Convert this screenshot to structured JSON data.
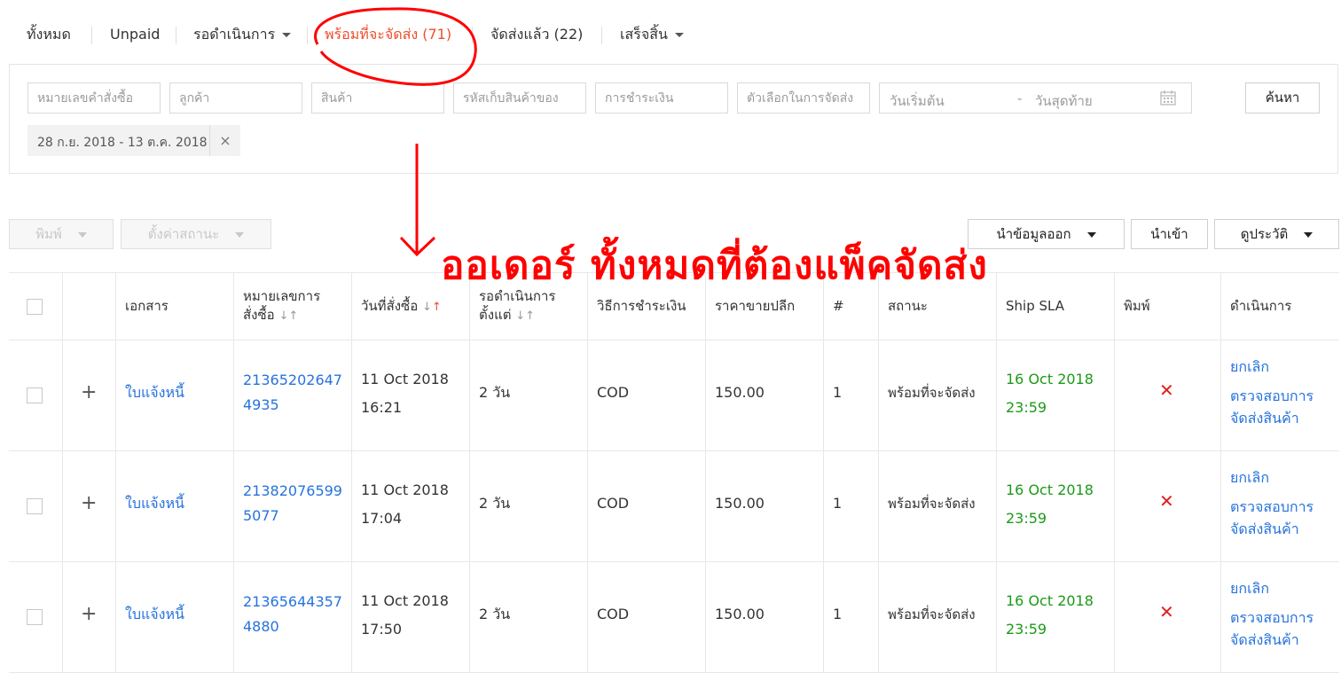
{
  "tabs": [
    {
      "label": "ทั้งหมด"
    },
    {
      "label": "Unpaid"
    },
    {
      "label": "รอดำเนินการ"
    },
    {
      "label": "พร้อมที่จะจัดส่ง (71)"
    },
    {
      "label": "จัดส่งแล้ว (22)"
    },
    {
      "label": "เสร็จสิ้น"
    }
  ],
  "filters": {
    "order_no_placeholder": "หมายเลขคำสั่งซื้อ",
    "customer_placeholder": "ลูกค้า",
    "product_placeholder": "สินค้า",
    "sku_placeholder": "รหัสเก็บสินค้าของ",
    "payment_placeholder": "การชำระเงิน",
    "shipping_option_placeholder": "ตัวเลือกในการจัดส่ง",
    "date_start_placeholder": "วันเริ่มต้น",
    "date_sep": "-",
    "date_end_placeholder": "วันสุดท้าย",
    "search_label": "ค้นหา",
    "date_chip": "28 ก.ย. 2018 - 13 ต.ค. 2018",
    "chip_close": "×"
  },
  "actions": {
    "print": "พิมพ์",
    "set_status": "ตั้งค่าสถานะ",
    "export": "นำข้อมูลออก",
    "import": "นำเข้า",
    "history": "ดูประวัติ"
  },
  "annotation": {
    "text": "ออเดอร์ ทั้งหมดที่ต้องแพ็คจัดส่ง",
    "color": "#ff0000"
  },
  "table": {
    "headers": {
      "document": "เอกสาร",
      "order_no_line1": "หมายเลขการ",
      "order_no_line2": "สั่งซื้อ",
      "order_date": "วันที่สั่งซื้อ",
      "pending_line1": "รอดำเนินการ",
      "pending_line2": "ตั้งแต่",
      "payment": "วิธีการชำระเงิน",
      "retail_price": "ราคาขายปลีก",
      "qty": "#",
      "status": "สถานะ",
      "ship_sla": "Ship SLA",
      "print": "พิมพ์",
      "action": "ดำเนินการ"
    },
    "rows": [
      {
        "doc": "ใบแจ้งหนี้",
        "order_line1": "21365202647",
        "order_line2": "4935",
        "date_line1": "11 Oct 2018",
        "date_line2": "16:21",
        "pending": "2 วัน",
        "payment": "COD",
        "price": "150.00",
        "qty": "1",
        "status": "พร้อมที่จะจัดส่ง",
        "sla_line1": "16 Oct 2018",
        "sla_line2": "23:59",
        "action_cancel": "ยกเลิก",
        "action_check_line1": "ตรวจสอบการ",
        "action_check_line2": "จัดส่งสินค้า"
      },
      {
        "doc": "ใบแจ้งหนี้",
        "order_line1": "21382076599",
        "order_line2": "5077",
        "date_line1": "11 Oct 2018",
        "date_line2": "17:04",
        "pending": "2 วัน",
        "payment": "COD",
        "price": "150.00",
        "qty": "1",
        "status": "พร้อมที่จะจัดส่ง",
        "sla_line1": "16 Oct 2018",
        "sla_line2": "23:59",
        "action_cancel": "ยกเลิก",
        "action_check_line1": "ตรวจสอบการ",
        "action_check_line2": "จัดส่งสินค้า"
      },
      {
        "doc": "ใบแจ้งหนี้",
        "order_line1": "21365644357",
        "order_line2": "4880",
        "date_line1": "11 Oct 2018",
        "date_line2": "17:50",
        "pending": "2 วัน",
        "payment": "COD",
        "price": "150.00",
        "qty": "1",
        "status": "พร้อมที่จะจัดส่ง",
        "sla_line1": "16 Oct 2018",
        "sla_line2": "23:59",
        "action_cancel": "ยกเลิก",
        "action_check_line1": "ตรวจสอบการ",
        "action_check_line2": "จัดส่งสินค้า"
      }
    ]
  },
  "colors": {
    "accent": "#ee4d2d",
    "link": "#2673dd",
    "sla_green": "#1a9a16",
    "cross_red": "#e02020"
  },
  "icons": {
    "expand": "plus-icon",
    "not_printed": "cross-icon",
    "calendar": "calendar-icon",
    "dropdown": "caret-down-icon"
  }
}
